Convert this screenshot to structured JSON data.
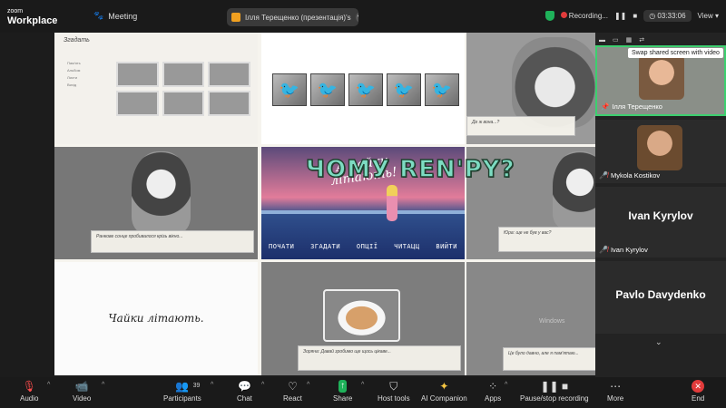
{
  "app": {
    "brand_line1": "zoom",
    "brand_line2": "Workplace",
    "meeting_label": "Meeting"
  },
  "share": {
    "presenter_label": "Ілля Терещенко (презентація)'s"
  },
  "top_right": {
    "recording_label": "Recording...",
    "timer": "03:33:06",
    "view_label": "View"
  },
  "slide": {
    "headline": "ЧОМУ REN'PY?",
    "c1_title": "Згадать",
    "c1_menu": [
      "Пам'ять",
      "Альбом",
      "Листи",
      "Вихід"
    ],
    "c3_dialog": "Де ж вона...?",
    "c4_dialog": "Ранкове сонце пробивалося крізь вікно...",
    "c5_title_line1": "А чайки",
    "c5_title_line2": "літають!",
    "c5_menu": [
      "ПОЧАТИ",
      "ЗГАДАТИ",
      "ОПЦІЇ",
      "ЧИТАЦЦ",
      "ВИЙТИ"
    ],
    "c6_dialog": "Юра: ще не був у вас?",
    "c7_caption": "Чайки літають.",
    "c8_dialog": "Зоряна: Давай зробимо ще щось цікаве...",
    "c9_dialog": "Це було давно, але я пам'ятаю...",
    "c9_watermark": "Windows"
  },
  "sidebar": {
    "tooltip": "Swap shared screen with video",
    "tiles": [
      {
        "name": "Ілля Терещенко",
        "muted": false
      },
      {
        "name": "Mykola Kostikov",
        "muted": true
      },
      {
        "name": "Ivan Kyrylov",
        "big_name": "Ivan Kyrylov",
        "muted": true
      },
      {
        "name": "Pavlo Davydenko",
        "big_name": "Pavlo Davydenko",
        "muted": true
      }
    ]
  },
  "toolbar": {
    "audio": "Audio",
    "video": "Video",
    "participants": "Participants",
    "participants_count": "39",
    "chat": "Chat",
    "react": "React",
    "share": "Share",
    "host_tools": "Host tools",
    "ai_companion": "AI Companion",
    "apps": "Apps",
    "pause_stop": "Pause/stop recording",
    "more": "More",
    "end": "End"
  },
  "colors": {
    "accent_green": "#3dcf6f",
    "record_red": "#e23b3b",
    "headline": "#7ddcc2"
  }
}
